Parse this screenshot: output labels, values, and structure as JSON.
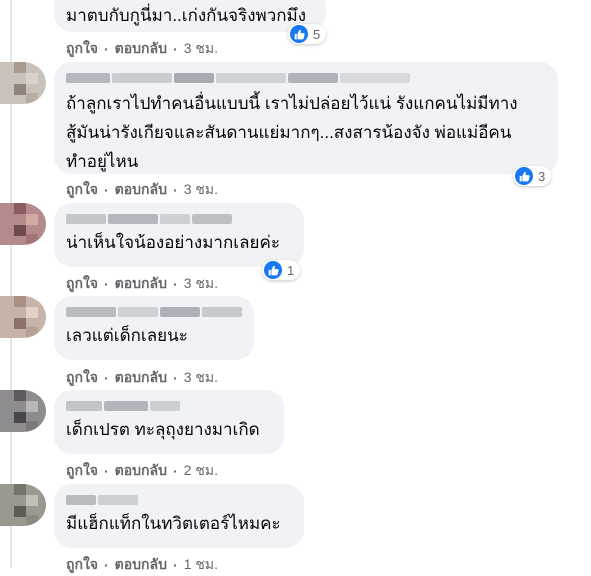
{
  "actions": {
    "like_label": "ถูกใจ",
    "reply_label": "ตอบกลับ",
    "separator": "·"
  },
  "comments": [
    {
      "text": "มาตบกับกูนี่มา..เก่งกันจริงพวกมึง",
      "time": "3 ชม.",
      "reactions": "5"
    },
    {
      "text": "ถ้าลูกเราไปทำคนอื่นแบบนี้ เราไม่ปล่อยไว้แน่ รังแกคนไม่มีทาง\nสู้มันน่ารังเกียจและสันดานแย่มากๆ...สงสารน้องจัง พ่อแม่อีคน\nทำอยู่ไหน",
      "time": "3 ชม.",
      "reactions": "3"
    },
    {
      "text": "น่าเห็นใจน้องอย่างมากเลยค่ะ",
      "time": "3 ชม.",
      "reactions": "1"
    },
    {
      "text": "เลวแต่เด็กเลยนะ",
      "time": "3 ชม.",
      "reactions": ""
    },
    {
      "text": "เด็กเปรต ทะลุถุงยางมาเกิด",
      "time": "2 ชม.",
      "reactions": ""
    },
    {
      "text": "มีแฮ็กแท็กในทวิตเตอร์ไหมคะ",
      "time": "1 ชม.",
      "reactions": ""
    }
  ],
  "colors": {
    "bubble": "#f0f2f5",
    "like_blue": "#1877f2",
    "meta_gray": "#65676b"
  },
  "icons": {
    "reaction": "like-thumbs-up-icon",
    "avatar": "blurred-avatar"
  }
}
